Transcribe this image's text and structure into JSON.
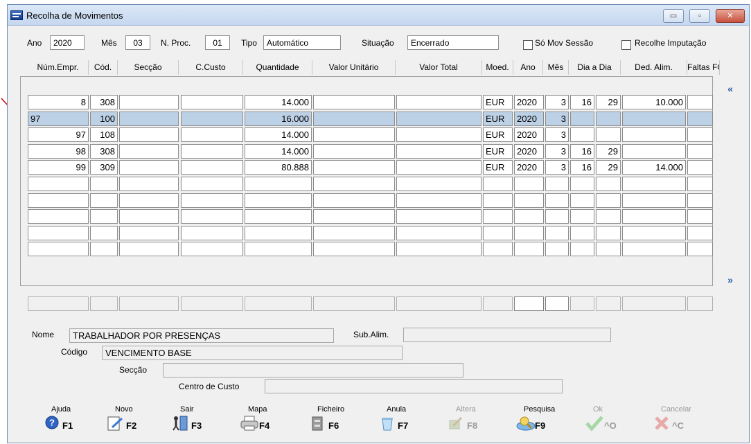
{
  "window": {
    "title": "Recolha de Movimentos",
    "min_glyph": "▭",
    "max_glyph": "▫",
    "close_glyph": "✕"
  },
  "header": {
    "ano_label": "Ano",
    "ano_value": "2020",
    "mes_label": "Mês",
    "mes_value": "03",
    "nproc_label": "N. Proc.",
    "nproc_value": "01",
    "tipo_label": "Tipo",
    "tipo_value": "Automático",
    "situacao_label": "Situação",
    "situacao_value": "Encerrado",
    "so_mov_sessao": "Só Mov Sessão",
    "recolhe_imputacao": "Recolhe Imputação"
  },
  "columns": [
    "Núm.Empr.",
    "Cód.",
    "Secção",
    "C.Custo",
    "Quantidade",
    "Valor Unitário",
    "Valor Total",
    "Moed.",
    "Ano",
    "Mês",
    "Dia a Dia",
    "",
    "Ded. Alim.",
    "Faltas FCT"
  ],
  "rows": [
    [
      "8",
      "308",
      "",
      "",
      "14.000",
      "",
      "",
      "EUR",
      "2020",
      "3",
      "16",
      "29",
      "10.000",
      ""
    ],
    [
      "97",
      "100",
      "",
      "",
      "16.000",
      "",
      "",
      "EUR",
      "2020",
      "3",
      "",
      "",
      "",
      ""
    ],
    [
      "97",
      "108",
      "",
      "",
      "14.000",
      "",
      "",
      "EUR",
      "2020",
      "3",
      "",
      "",
      "",
      ""
    ],
    [
      "98",
      "308",
      "",
      "",
      "14.000",
      "",
      "",
      "EUR",
      "2020",
      "3",
      "16",
      "29",
      "",
      ""
    ],
    [
      "99",
      "309",
      "",
      "",
      "80.888",
      "",
      "",
      "EUR",
      "2020",
      "3",
      "16",
      "29",
      "14.000",
      ""
    ],
    [
      "",
      "",
      "",
      "",
      "",
      "",
      "",
      "",
      "",
      "",
      "",
      "",
      "",
      ""
    ],
    [
      "",
      "",
      "",
      "",
      "",
      "",
      "",
      "",
      "",
      "",
      "",
      "",
      "",
      ""
    ],
    [
      "",
      "",
      "",
      "",
      "",
      "",
      "",
      "",
      "",
      "",
      "",
      "",
      "",
      ""
    ],
    [
      "",
      "",
      "",
      "",
      "",
      "",
      "",
      "",
      "",
      "",
      "",
      "",
      "",
      ""
    ],
    [
      "",
      "",
      "",
      "",
      "",
      "",
      "",
      "",
      "",
      "",
      "",
      "",
      "",
      ""
    ]
  ],
  "selected_row": 1,
  "scroll": {
    "up": "«",
    "down": "»"
  },
  "details": {
    "nome_label": "Nome",
    "nome_value": "TRABALHADOR POR PRESENÇAS",
    "sub_alim_label": "Sub.Alim.",
    "sub_alim_value": "",
    "codigo_label": "Código",
    "codigo_value": "VENCIMENTO BASE",
    "seccao_label": "Secção",
    "seccao_value": "",
    "centro_label": "Centro de Custo",
    "centro_value": ""
  },
  "buttons": [
    {
      "caption": "Ajuda",
      "key": "F1",
      "icon": "help-icon",
      "disabled": false
    },
    {
      "caption": "Novo",
      "key": "F2",
      "icon": "new-document-icon",
      "disabled": false
    },
    {
      "caption": "Sair",
      "key": "F3",
      "icon": "exit-door-icon",
      "disabled": false
    },
    {
      "caption": "Mapa",
      "key": "F4",
      "icon": "printer-icon",
      "disabled": false
    },
    {
      "caption": "Ficheiro",
      "key": "F6",
      "icon": "file-cabinet-icon",
      "disabled": false
    },
    {
      "caption": "Anula",
      "key": "F7",
      "icon": "recycle-bin-icon",
      "disabled": false
    },
    {
      "caption": "Altera",
      "key": "F8",
      "icon": "edit-icon",
      "disabled": true
    },
    {
      "caption": "Pesquisa",
      "key": "F9",
      "icon": "search-icon",
      "disabled": false
    },
    {
      "caption": "Ok",
      "key": "^O",
      "icon": "checkmark-icon",
      "disabled": true
    },
    {
      "caption": "Cancelar",
      "key": "^C",
      "icon": "cancel-x-icon",
      "disabled": true
    }
  ],
  "colors": {
    "selection": "#bcd0e6",
    "arrow": "#c00000",
    "accent": "#2a5ea8"
  }
}
